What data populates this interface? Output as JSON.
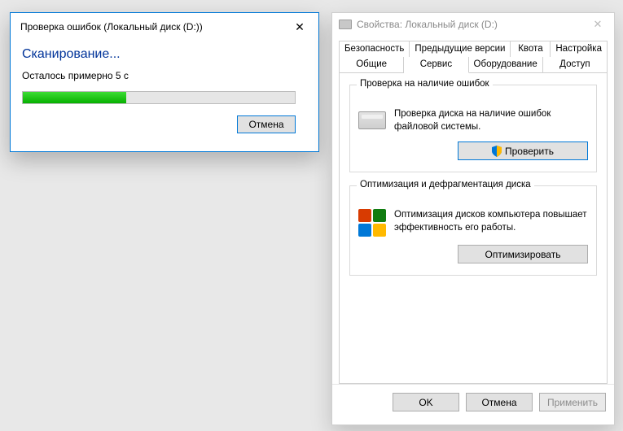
{
  "scan": {
    "title": "Проверка ошибок (Локальный диск (D:))",
    "heading": "Сканирование...",
    "status": "Осталось примерно 5 с",
    "progress_percent": 38,
    "cancel": "Отмена"
  },
  "properties": {
    "title": "Свойства: Локальный диск (D:)",
    "tabs_row1": [
      "Безопасность",
      "Предыдущие версии",
      "Квота",
      "Настройка"
    ],
    "tabs_row2": [
      "Общие",
      "Сервис",
      "Оборудование",
      "Доступ"
    ],
    "active_tab": "Сервис",
    "group_check": {
      "title": "Проверка на наличие ошибок",
      "text": "Проверка диска на наличие ошибок файловой системы.",
      "button": "Проверить"
    },
    "group_defrag": {
      "title": "Оптимизация и дефрагментация диска",
      "text": "Оптимизация дисков компьютера повышает эффективность его работы.",
      "button": "Оптимизировать"
    },
    "buttons": {
      "ok": "OK",
      "cancel": "Отмена",
      "apply": "Применить"
    }
  }
}
